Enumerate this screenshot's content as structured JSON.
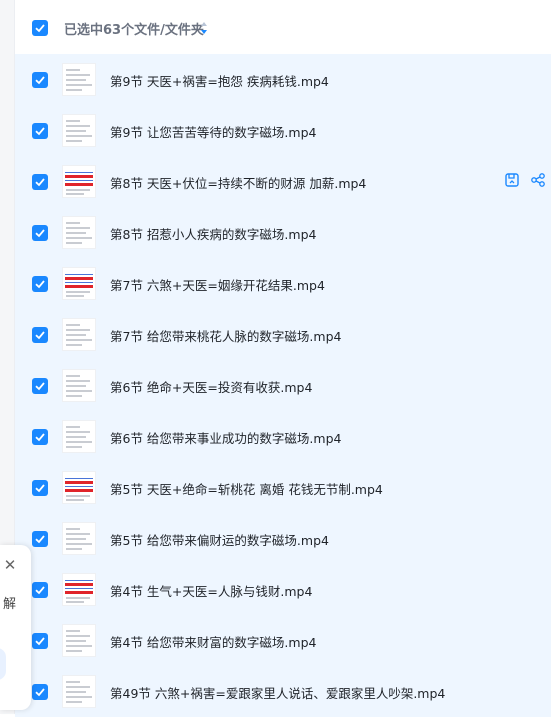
{
  "header": {
    "label": "已选中63个文件/文件夹"
  },
  "side_panel": {
    "close_glyph": "✕",
    "label": "解"
  },
  "colors": {
    "accent": "#1a88ff",
    "row_selected_bg": "#eef6ff"
  },
  "files": [
    {
      "name": "第9节 天医+祸害=抱怨 疾病耗钱.mp4",
      "checked": true,
      "thumb": "text"
    },
    {
      "name": "第9节 让您苦苦等待的数字磁场.mp4",
      "checked": true,
      "thumb": "text"
    },
    {
      "name": "第8节 天医+伏位=持续不断的财源 加薪.mp4",
      "checked": true,
      "thumb": "table"
    },
    {
      "name": "第8节 招惹小人疾病的数字磁场.mp4",
      "checked": true,
      "thumb": "text"
    },
    {
      "name": "第7节 六煞+天医=姻缘开花结果.mp4",
      "checked": true,
      "thumb": "table"
    },
    {
      "name": "第7节 给您带来桃花人脉的数字磁场.mp4",
      "checked": true,
      "thumb": "text"
    },
    {
      "name": "第6节 绝命+天医=投资有收获.mp4",
      "checked": true,
      "thumb": "text"
    },
    {
      "name": "第6节 给您带来事业成功的数字磁场.mp4",
      "checked": true,
      "thumb": "text"
    },
    {
      "name": "第5节 天医+绝命=斩桃花 离婚 花钱无节制.mp4",
      "checked": true,
      "thumb": "table"
    },
    {
      "name": "第5节 给您带来偏财运的数字磁场.mp4",
      "checked": true,
      "thumb": "text"
    },
    {
      "name": "第4节 生气+天医=人脉与钱财.mp4",
      "checked": true,
      "thumb": "table"
    },
    {
      "name": "第4节 给您带来财富的数字磁场.mp4",
      "checked": true,
      "thumb": "text"
    },
    {
      "name": "第49节 六煞+祸害=爱跟家里人说话、爱跟家里人吵架.mp4",
      "checked": true,
      "thumb": "text"
    }
  ],
  "hovered_row_actions": {
    "row": 2,
    "icons": [
      "save-to-disk-icon",
      "share-icon"
    ]
  }
}
